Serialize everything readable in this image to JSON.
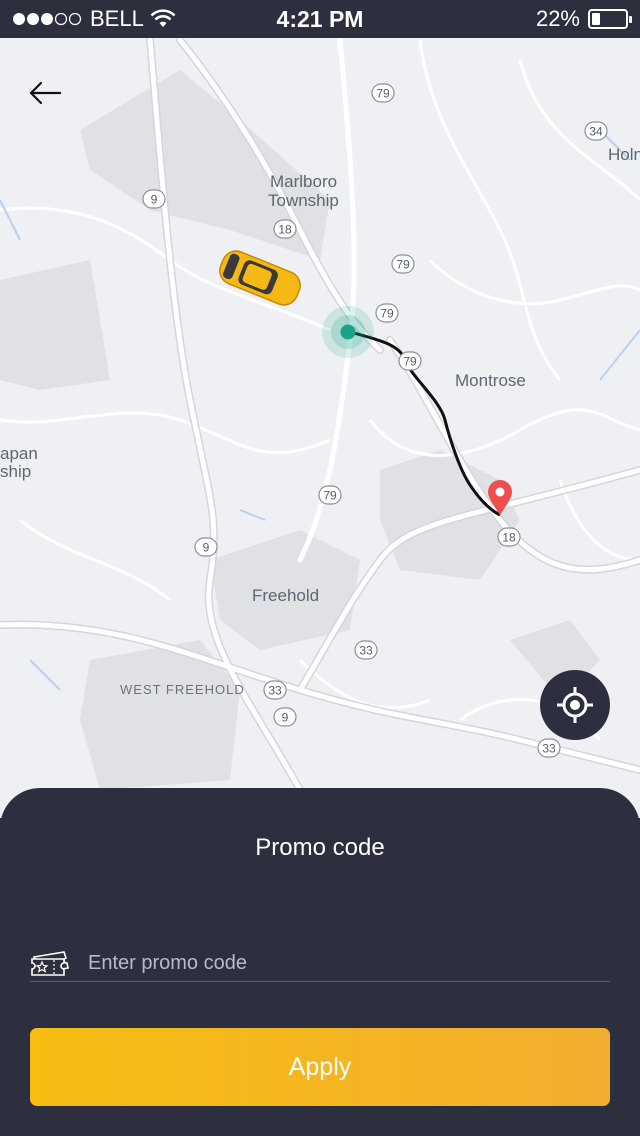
{
  "status_bar": {
    "carrier": "BELL",
    "time": "4:21 PM",
    "battery": "22%",
    "battery_level": 0.22,
    "signal_dots": 5,
    "signal_filled": 3
  },
  "map": {
    "place_labels": [
      "Marlboro",
      "Township",
      "Montrose",
      "Freehold",
      "WEST FREEHOLD",
      "Holn",
      "apan",
      "ship"
    ],
    "route_shields": [
      "79",
      "34",
      "9",
      "18",
      "79",
      "79",
      "79",
      "79",
      "9",
      "18",
      "33",
      "33",
      "9",
      "33"
    ],
    "colors": {
      "background": "#eef0f3",
      "park": "#dfe1e5",
      "road": "#ffffff",
      "route": "#111111",
      "pickup": "#1aa38a",
      "destination": "#f04e4e",
      "car": "#f5b814"
    }
  },
  "icons": {
    "back": "arrow-left-icon",
    "locate": "crosshair-icon",
    "promo": "ticket-icon",
    "car": "taxi-car-icon",
    "pickup": "pickup-dot-icon",
    "destination": "map-pin-icon"
  },
  "sheet": {
    "title": "Promo code",
    "promo_placeholder": "Enter promo code",
    "promo_value": "",
    "apply_label": "Apply"
  },
  "theme": {
    "dark": "#2d2f3f",
    "accent_start": "#f7bd12",
    "accent_end": "#f2ae2f",
    "divider": "#5b5e6e"
  }
}
